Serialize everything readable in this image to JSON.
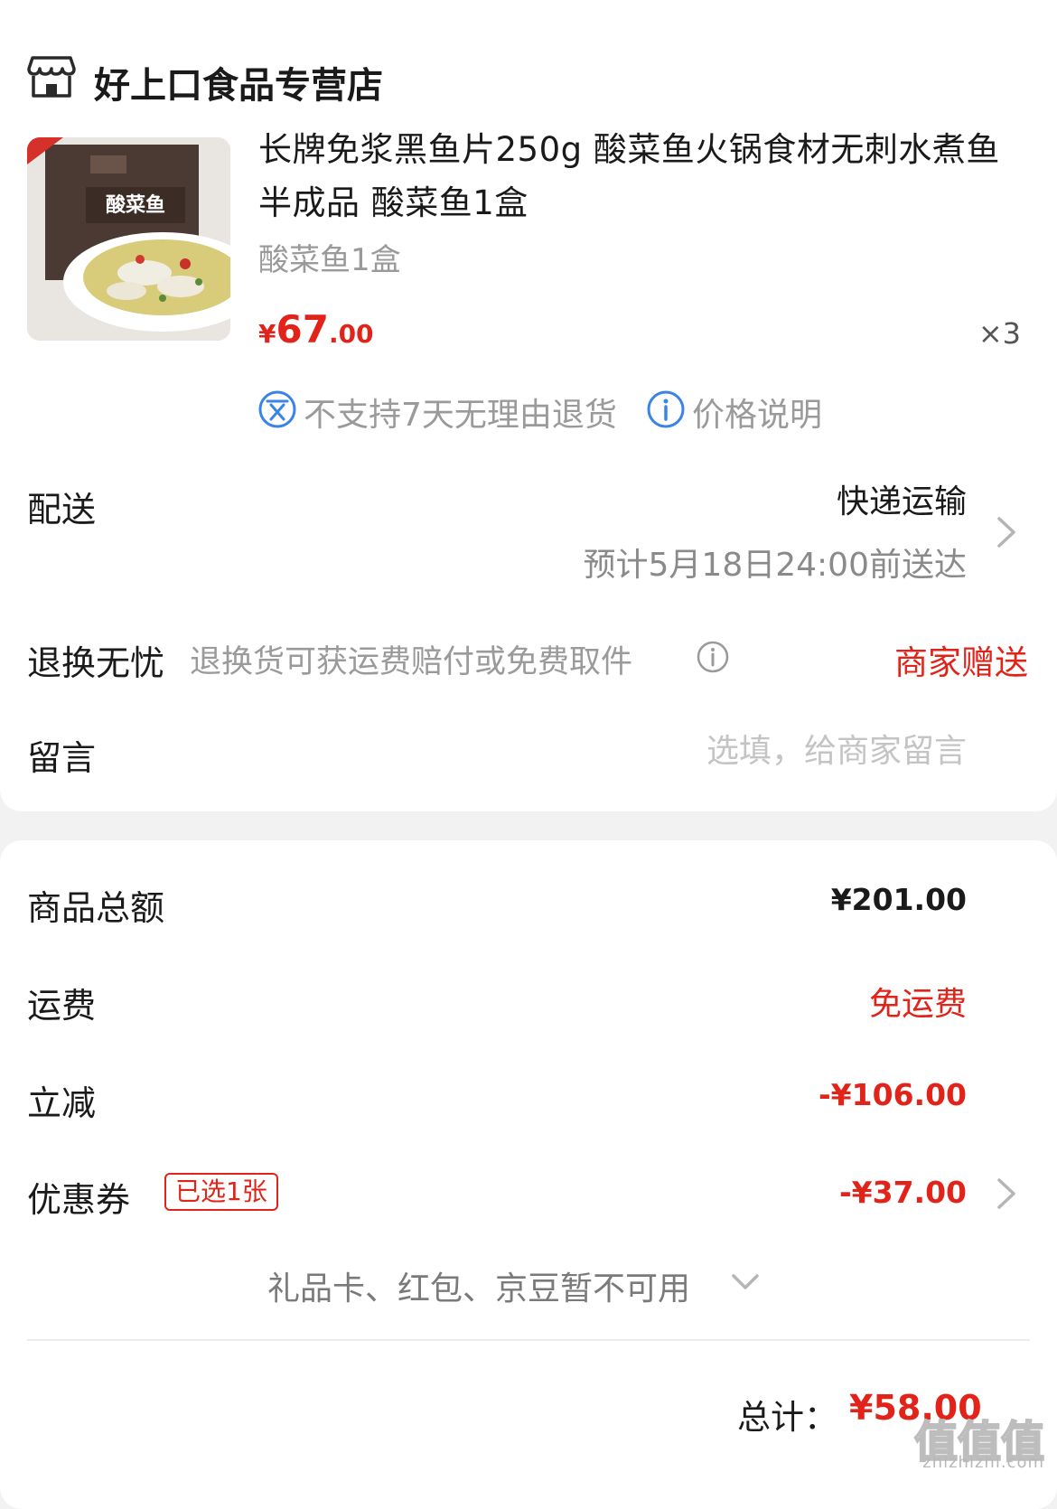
{
  "store": {
    "name": "好上口食品专营店",
    "icon": "store-icon"
  },
  "product": {
    "title": "长牌免浆黑鱼片250g 酸菜鱼火锅食材无刺水煮鱼半成品 酸菜鱼1盒",
    "spec": "酸菜鱼1盒",
    "price_currency": "¥",
    "price_integer": "67",
    "price_decimal": ".00",
    "quantity": "×3",
    "image_alt": "酸菜鱼"
  },
  "tags": {
    "no_return": "不支持7天无理由退货",
    "price_note": "价格说明"
  },
  "delivery": {
    "label": "配送",
    "method": "快递运输",
    "eta": "预计5月18日24:00前送达"
  },
  "returns": {
    "label": "退换无忧",
    "description": "退换货可获运费赔付或免费取件",
    "gift": "商家赠送"
  },
  "message": {
    "label": "留言",
    "placeholder": "选填，给商家留言"
  },
  "summary": {
    "subtotal_label": "商品总额",
    "subtotal_value": "¥201.00",
    "shipping_label": "运费",
    "shipping_value": "免运费",
    "discount_label": "立减",
    "discount_value": "-¥106.00",
    "coupon_label": "优惠券",
    "coupon_badge": "已选1张",
    "coupon_value": "-¥37.00",
    "unavailable": "礼品卡、红包、京豆暂不可用",
    "total_label": "总计：",
    "total_value": "¥58.00"
  },
  "watermark": {
    "logo": "值值值",
    "text": "zhizhizhi.com"
  },
  "colors": {
    "accent": "#e2231a",
    "icon_blue": "#3a84e8",
    "muted": "#9a9a9a"
  }
}
